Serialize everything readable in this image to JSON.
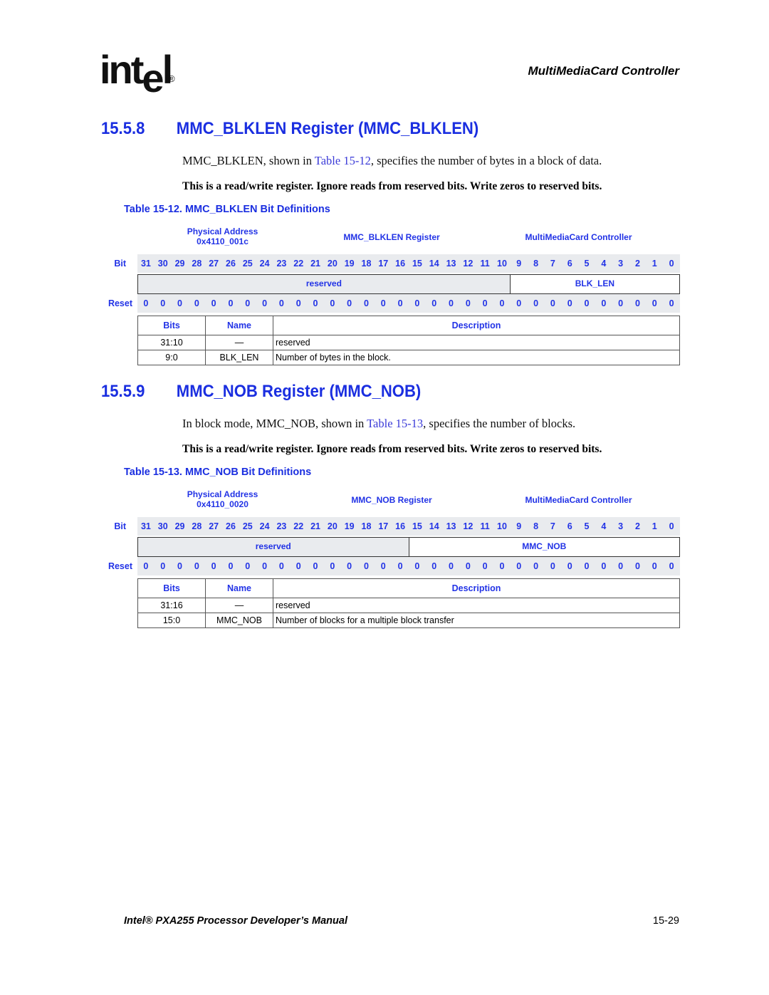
{
  "header": {
    "logo_text": "intel",
    "logo_reg": "®",
    "chapter": "MultiMediaCard Controller"
  },
  "sections": [
    {
      "number": "15.5.8",
      "title": "MMC_BLKLEN Register (MMC_BLKLEN)",
      "para_before": "MMC_BLKLEN, shown in ",
      "para_link": "Table 15-12",
      "para_after": ", specifies the number of bytes in a block of data.",
      "note": "This is a read/write register. Ignore reads from reserved bits. Write zeros to reserved bits.",
      "table_caption": "Table 15-12. MMC_BLKLEN Bit Definitions",
      "register": {
        "address_label": "Physical Address",
        "address": "0x4110_001c",
        "register_name": "MMC_BLKLEN Register",
        "unit": "MultiMediaCard Controller",
        "bit_label": "Bit",
        "reset_label": "Reset",
        "bits": [
          "31",
          "30",
          "29",
          "28",
          "27",
          "26",
          "25",
          "24",
          "23",
          "22",
          "21",
          "20",
          "19",
          "18",
          "17",
          "16",
          "15",
          "14",
          "13",
          "12",
          "11",
          "10",
          "9",
          "8",
          "7",
          "6",
          "5",
          "4",
          "3",
          "2",
          "1",
          "0"
        ],
        "reset": [
          "0",
          "0",
          "0",
          "0",
          "0",
          "0",
          "0",
          "0",
          "0",
          "0",
          "0",
          "0",
          "0",
          "0",
          "0",
          "0",
          "0",
          "0",
          "0",
          "0",
          "0",
          "0",
          "0",
          "0",
          "0",
          "0",
          "0",
          "0",
          "0",
          "0",
          "0",
          "0"
        ],
        "fields": [
          {
            "name": "reserved",
            "bits": 22
          },
          {
            "name": "BLK_LEN",
            "bits": 10
          }
        ]
      },
      "defs": {
        "headers": [
          "Bits",
          "Name",
          "Description"
        ],
        "rows": [
          {
            "bits": "31:10",
            "name": "—",
            "description": "reserved"
          },
          {
            "bits": "9:0",
            "name": "BLK_LEN",
            "description": "Number of bytes in the block."
          }
        ]
      }
    },
    {
      "number": "15.5.9",
      "title": "MMC_NOB Register (MMC_NOB)",
      "para_before": "In block mode, MMC_NOB, shown in ",
      "para_link": "Table 15-13",
      "para_after": ", specifies the number of blocks.",
      "note": "This is a read/write register. Ignore reads from reserved bits. Write zeros to reserved bits.",
      "table_caption": "Table 15-13. MMC_NOB Bit Definitions",
      "register": {
        "address_label": "Physical Address",
        "address": "0x4110_0020",
        "register_name": "MMC_NOB Register",
        "unit": "MultiMediaCard Controller",
        "bit_label": "Bit",
        "reset_label": "Reset",
        "bits": [
          "31",
          "30",
          "29",
          "28",
          "27",
          "26",
          "25",
          "24",
          "23",
          "22",
          "21",
          "20",
          "19",
          "18",
          "17",
          "16",
          "15",
          "14",
          "13",
          "12",
          "11",
          "10",
          "9",
          "8",
          "7",
          "6",
          "5",
          "4",
          "3",
          "2",
          "1",
          "0"
        ],
        "reset": [
          "0",
          "0",
          "0",
          "0",
          "0",
          "0",
          "0",
          "0",
          "0",
          "0",
          "0",
          "0",
          "0",
          "0",
          "0",
          "0",
          "0",
          "0",
          "0",
          "0",
          "0",
          "0",
          "0",
          "0",
          "0",
          "0",
          "0",
          "0",
          "0",
          "0",
          "0",
          "0"
        ],
        "fields": [
          {
            "name": "reserved",
            "bits": 16
          },
          {
            "name": "MMC_NOB",
            "bits": 16
          }
        ]
      },
      "defs": {
        "headers": [
          "Bits",
          "Name",
          "Description"
        ],
        "rows": [
          {
            "bits": "31:16",
            "name": "—",
            "description": "reserved"
          },
          {
            "bits": "15:0",
            "name": "MMC_NOB",
            "description": "Number of blocks for a multiple block transfer"
          }
        ]
      }
    }
  ],
  "footer": {
    "manual_title": "Intel® PXA255 Processor Developer’s Manual",
    "page_number": "15-29"
  }
}
